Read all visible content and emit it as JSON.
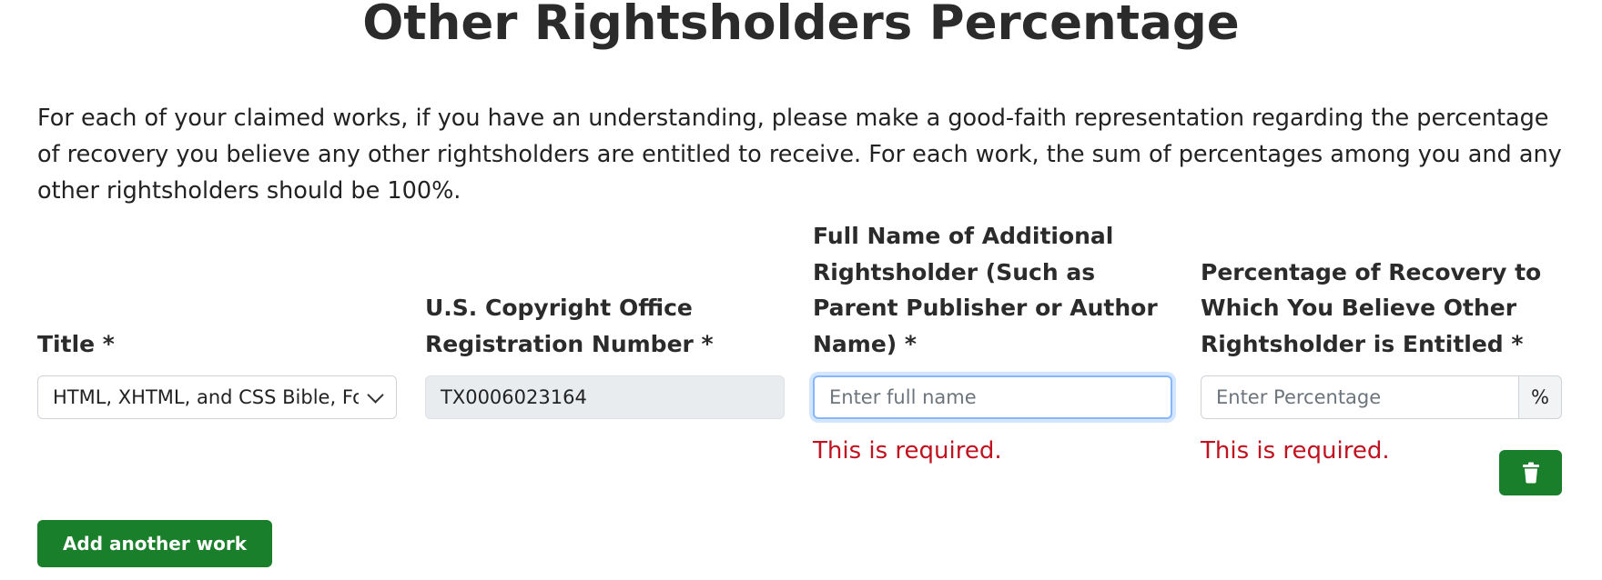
{
  "page": {
    "title": "Other Rightsholders Percentage",
    "intro": "For each of your claimed works, if you have an understanding, please make a good-faith representation regarding the percentage of recovery you believe any other rightsholders are entitled to receive. For each work, the sum of percentages among you and any other rightsholders should be 100%."
  },
  "fields": {
    "title": {
      "label": "Title *",
      "selected_value": "HTML, XHTML, and CSS Bible, Fourth Edition"
    },
    "registration": {
      "label": "U.S. Copyright Office Registration Number *",
      "value": "TX0006023164"
    },
    "full_name": {
      "label": "Full Name of Additional Rightsholder (Such as Parent Publisher or Author Name) *",
      "placeholder": "Enter full name",
      "error": "This is required."
    },
    "percentage": {
      "label": "Percentage of Recovery to Which You Believe Other Rightsholder is Entitled *",
      "placeholder": "Enter Percentage",
      "suffix": "%",
      "error": "This is required."
    }
  },
  "actions": {
    "delete_icon": "trash-icon",
    "add_work_label": "Add another work"
  },
  "colors": {
    "primary_green": "#1a7f2a",
    "error_red": "#c1121f",
    "focus_blue": "#86b7fe",
    "disabled_bg": "#e9ecef"
  }
}
